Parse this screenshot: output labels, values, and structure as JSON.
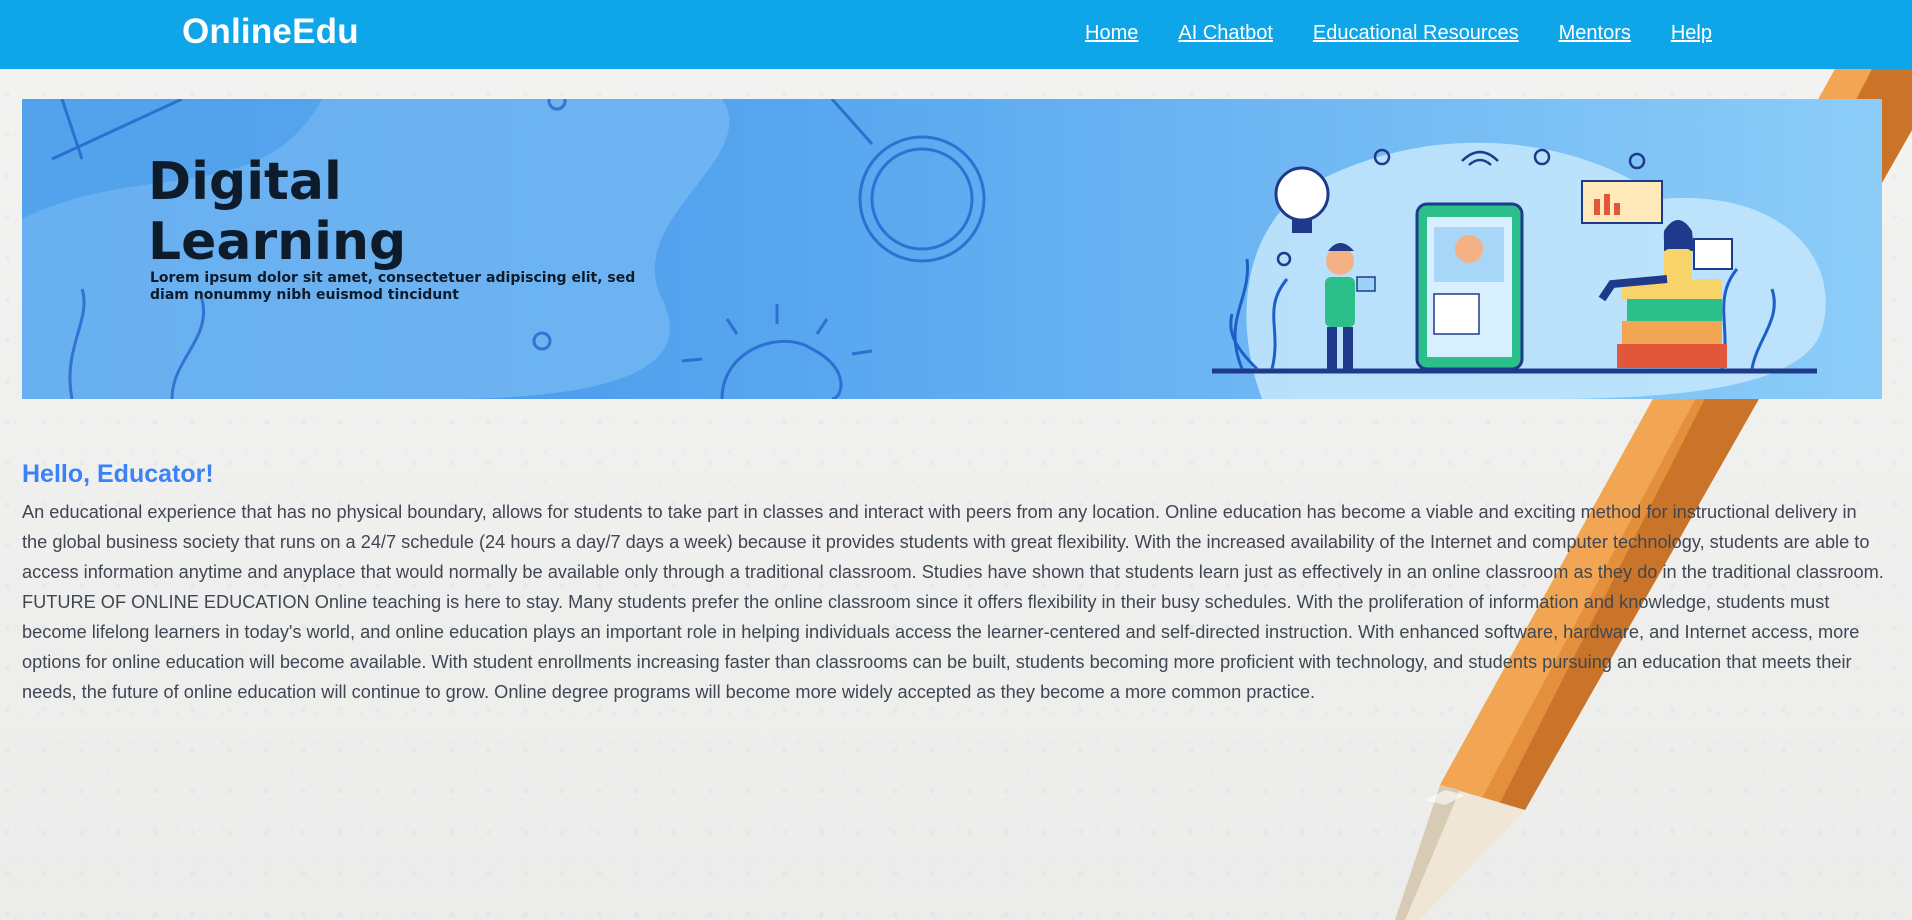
{
  "header": {
    "logo": "OnlineEdu",
    "nav": [
      {
        "label": "Home"
      },
      {
        "label": "AI Chatbot"
      },
      {
        "label": "Educational Resources"
      },
      {
        "label": "Mentors"
      },
      {
        "label": "Help"
      }
    ]
  },
  "banner": {
    "title_line1": "Digital",
    "title_line2": "Learning",
    "caption_line1": "Lorem ipsum dolor sit amet, consectetuer adipiscing elit, sed",
    "caption_line2": "diam nonummy nibh euismod tincidunt"
  },
  "main": {
    "greeting": "Hello, Educator!",
    "paragraph": "An educational experience that has no physical boundary, allows for students to take part in classes and interact with peers from any location. Online education has become a viable and exciting method for instructional delivery in the global business society that runs on a 24/7 schedule (24 hours a day/7 days a week) because it provides students with great flexibility. With the increased availability of the Internet and computer technology, students are able to access information anytime and anyplace that would normally be available only through a traditional classroom. Studies have shown that students learn just as effectively in an online classroom as they do in the traditional classroom. FUTURE OF ONLINE EDUCATION Online teaching is here to stay. Many students prefer the online classroom since it offers flexibility in their busy schedules. With the proliferation of information and knowledge, students must become lifelong learners in today's world, and online education plays an important role in helping individuals access the learner-centered and self-directed instruction. With enhanced software, hardware, and Internet access, more options for online education will become available. With student enrollments increasing faster than classrooms can be built, students becoming more proficient with technology, and students pursuing an education that meets their needs, the future of online education will continue to grow. Online degree programs will become more widely accepted as they become a more common practice."
  },
  "colors": {
    "header_bg": "#0ea5e9",
    "greeting": "#3b82f6",
    "body_text": "#3f4753",
    "pencil_body": "#e08a3a"
  }
}
